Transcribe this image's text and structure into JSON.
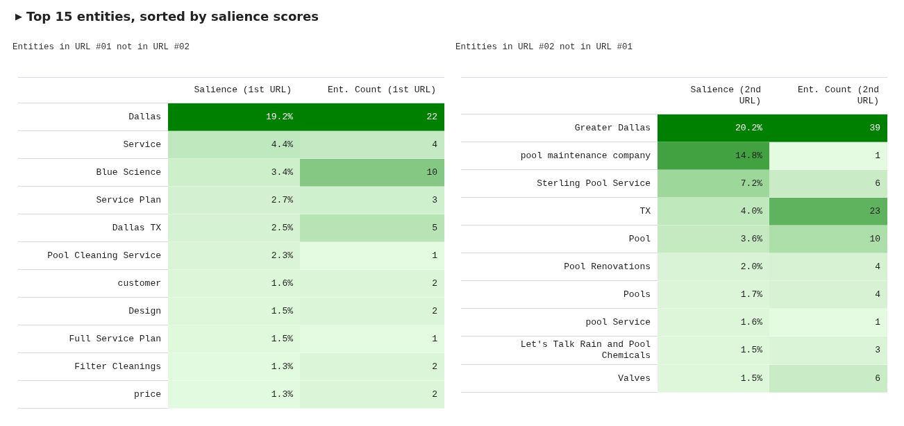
{
  "section": {
    "toggle": "▶",
    "title": "Top 15 entities, sorted by salience scores"
  },
  "tables": [
    {
      "caption": "Entities in URL #01 not in URL #02",
      "columns": [
        "Salience (1st URL)",
        "Ent. Count (1st URL)"
      ],
      "rows": [
        {
          "entity": "Dallas",
          "salience": {
            "text": "19.2%",
            "color": "#008000"
          },
          "count": {
            "text": "22",
            "color": "#008000"
          }
        },
        {
          "entity": "Service",
          "salience": {
            "text": "4.4%",
            "color": "#c0e8be"
          },
          "count": {
            "text": "4",
            "color": "#c5eac3"
          }
        },
        {
          "entity": "Blue Science",
          "salience": {
            "text": "3.4%",
            "color": "#cdefca"
          },
          "count": {
            "text": "10",
            "color": "#84c884"
          }
        },
        {
          "entity": "Service Plan",
          "salience": {
            "text": "2.7%",
            "color": "#d3f1d0"
          },
          "count": {
            "text": "3",
            "color": "#cff0cc"
          }
        },
        {
          "entity": "Dallas TX",
          "salience": {
            "text": "2.5%",
            "color": "#d5f2d2"
          },
          "count": {
            "text": "5",
            "color": "#b7e3b5"
          }
        },
        {
          "entity": "Pool Cleaning Service",
          "salience": {
            "text": "2.3%",
            "color": "#d9f4d6"
          },
          "count": {
            "text": "1",
            "color": "#e4fbe1"
          }
        },
        {
          "entity": "customer",
          "salience": {
            "text": "1.6%",
            "color": "#ddf6da"
          },
          "count": {
            "text": "2",
            "color": "#dbf5d8"
          }
        },
        {
          "entity": "Design",
          "salience": {
            "text": "1.5%",
            "color": "#def7db"
          },
          "count": {
            "text": "2",
            "color": "#dbf5d8"
          }
        },
        {
          "entity": "Full Service Plan",
          "salience": {
            "text": "1.5%",
            "color": "#e0f9dd"
          },
          "count": {
            "text": "1",
            "color": "#e4fbe1"
          }
        },
        {
          "entity": "Filter Cleanings",
          "salience": {
            "text": "1.3%",
            "color": "#e2fadf"
          },
          "count": {
            "text": "2",
            "color": "#dbf5d8"
          }
        },
        {
          "entity": "price",
          "salience": {
            "text": "1.3%",
            "color": "#e2fadf"
          },
          "count": {
            "text": "2",
            "color": "#dbf5d8"
          }
        }
      ]
    },
    {
      "caption": "Entities in URL #02 not in URL #01",
      "columns": [
        "Salience (2nd URL)",
        "Ent. Count (2nd URL)"
      ],
      "rows": [
        {
          "entity": "Greater Dallas",
          "salience": {
            "text": "20.2%",
            "color": "#008000"
          },
          "count": {
            "text": "39",
            "color": "#008000"
          }
        },
        {
          "entity": "pool maintenance company",
          "salience": {
            "text": "14.8%",
            "color": "#42a242"
          },
          "count": {
            "text": "1",
            "color": "#e4fbe1"
          }
        },
        {
          "entity": "Sterling Pool Service",
          "salience": {
            "text": "7.2%",
            "color": "#9dd89a"
          },
          "count": {
            "text": "6",
            "color": "#c9ecc6"
          }
        },
        {
          "entity": "TX",
          "salience": {
            "text": "4.0%",
            "color": "#c0e8bd"
          },
          "count": {
            "text": "23",
            "color": "#5fb35f"
          }
        },
        {
          "entity": "Pool",
          "salience": {
            "text": "3.6%",
            "color": "#c5eac2"
          },
          "count": {
            "text": "10",
            "color": "#addfab"
          }
        },
        {
          "entity": "Pool Renovations",
          "salience": {
            "text": "2.0%",
            "color": "#d8f3d5"
          },
          "count": {
            "text": "4",
            "color": "#d6f2d3"
          }
        },
        {
          "entity": "Pools",
          "salience": {
            "text": "1.7%",
            "color": "#dcf5d9"
          },
          "count": {
            "text": "4",
            "color": "#d6f2d3"
          }
        },
        {
          "entity": "pool Service",
          "salience": {
            "text": "1.6%",
            "color": "#ddf6da"
          },
          "count": {
            "text": "1",
            "color": "#e4fbe1"
          }
        },
        {
          "entity": "Let's Talk Rain and Pool Chemicals",
          "salience": {
            "text": "1.5%",
            "color": "#def7db"
          },
          "count": {
            "text": "3",
            "color": "#daf4d7"
          }
        },
        {
          "entity": "Valves",
          "salience": {
            "text": "1.5%",
            "color": "#def7db"
          },
          "count": {
            "text": "6",
            "color": "#c9ecc6"
          }
        }
      ]
    }
  ]
}
